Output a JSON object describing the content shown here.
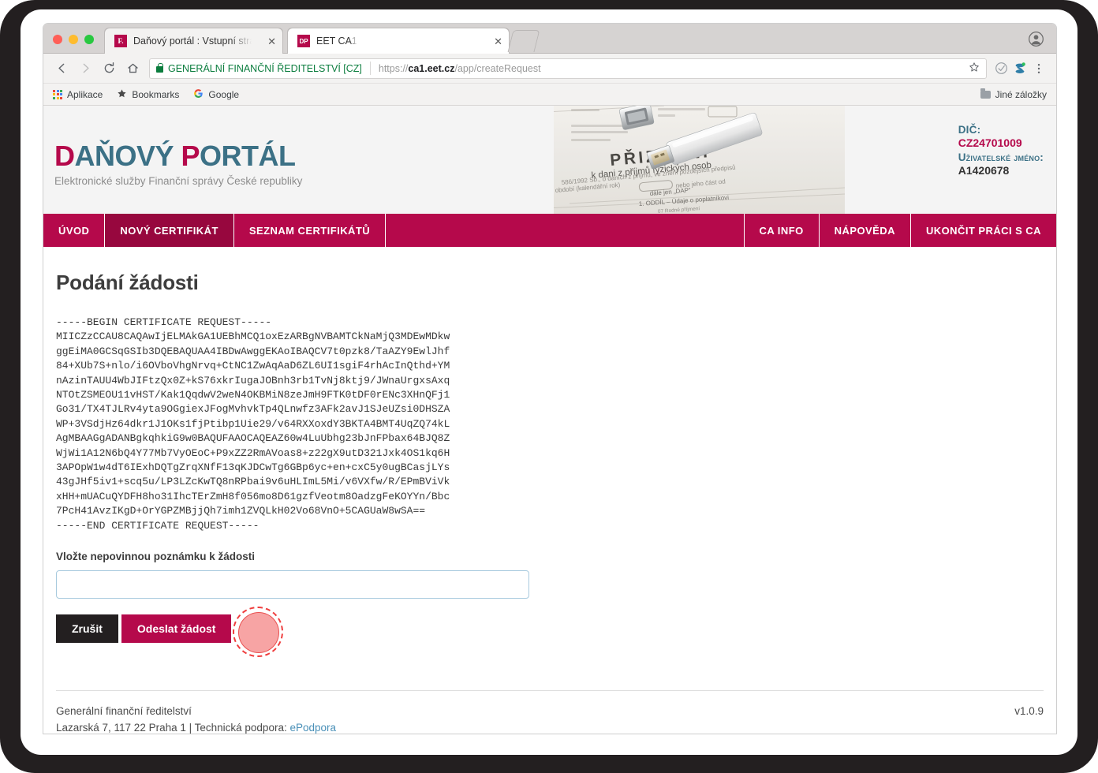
{
  "browser": {
    "tabs": [
      {
        "favicon": "favicon-danovy-portal",
        "favicon_text": "F.",
        "title": "Daňový portál :  Vstupní stránk",
        "active": true,
        "close_label": "✕"
      },
      {
        "favicon": "favicon-eet-ca1",
        "favicon_text": "DP",
        "title": "EET CA1",
        "active": false,
        "close_label": "✕"
      }
    ],
    "toolbar": {
      "back_icon": "back-arrow-icon",
      "forward_icon": "forward-arrow-icon",
      "reload_icon": "reload-icon",
      "home_icon": "home-icon",
      "ev_certificate": "GENERÁLNÍ FINANČNÍ ŘEDITELSTVÍ [CZ]",
      "url_scheme": "https://",
      "url_host": "ca1.eet.cz",
      "url_path": "/app/createRequest",
      "star_icon": "bookmark-star-icon",
      "extension_icon": "extension-icon",
      "sync_icon": "sync-icon",
      "menu_icon": "kebab-menu-icon",
      "profile_icon": "profile-avatar-icon"
    },
    "bookmarks": {
      "apps_label": "Aplikace",
      "bookmarks_label": "Bookmarks",
      "google_label": "Google",
      "other_label": "Jiné záložky"
    }
  },
  "site": {
    "logo": {
      "part1_accent": "D",
      "part1_rest": "AŇOVÝ ",
      "part2_accent": "P",
      "part2_rest": "ORTÁL"
    },
    "logo_subtitle": "Elektronické služby Finanční správy České republiky",
    "banner_alt": "priznani-form-usb-photo",
    "identity": {
      "dic_label": "DIČ:",
      "dic_value": "CZ24701009",
      "user_label": "Uživatelské jméno:",
      "user_value": "A1420678"
    },
    "nav_left": [
      {
        "label": "ÚVOD",
        "active": false
      },
      {
        "label": "NOVÝ CERTIFIKÁT",
        "active": true
      },
      {
        "label": "SEZNAM CERTIFIKÁTŮ",
        "active": false
      }
    ],
    "nav_right": [
      {
        "label": "CA INFO",
        "active": false
      },
      {
        "label": "NÁPOVĚDA",
        "active": false
      },
      {
        "label": "UKONČIT PRÁCI S CA",
        "active": false
      }
    ]
  },
  "main": {
    "page_title": "Podání žádosti",
    "certificate_request": "-----BEGIN CERTIFICATE REQUEST-----\nMIICZzCCAU8CAQAwIjELMAkGA1UEBhMCQ1oxEzARBgNVBAMTCkNaMjQ3MDEwMDkw\nggEiMA0GCSqGSIb3DQEBAQUAA4IBDwAwggEKAoIBAQCV7t0pzk8/TaAZY9EwlJhf\n84+XUb7S+nlo/i6OVboVhgNrvq+CtNC1ZwAqAaD6ZL6UI1sgiF4rhAcInQthd+YM\nnAzinTAUU4WbJIFtzQx0Z+kS76xkrIugaJOBnh3rb1TvNj8ktj9/JWnaUrgxsAxq\nNTOtZSMEOU11vHST/Kak1QqdwV2weN4OKBMiN8zeJmH9FTK0tDF0rENc3XHnQFj1\nGo31/TX4TJLRv4yta9OGgiexJFogMvhvkTp4QLnwfz3AFk2avJ1SJeUZsi0DHSZA\nWP+3VSdjHz64dkr1J1OKs1fjPtibp1Uie29/v64RXXoxdY3BKTA4BMT4UqZQ74kL\nAgMBAAGgADANBgkqhkiG9w0BAQUFAAOCAQEAZ60w4LuUbhg23bJnFPbax64BJQ8Z\nWjWi1A12N6bQ4Y77Mb7VyOEoC+P9xZZ2RmAVoas8+z22gX9utD321Jxk4OS1kq6H\n3APOpW1w4dT6IExhDQTgZrqXNfF13qKJDCwTg6GBp6yc+en+cxC5y0ugBCasjLYs\n43gJHf5iv1+scq5u/LP3LZcKwTQ8nRPbai9v6uHLImL5Mi/v6VXfw/R/EPmBViVk\nxHH+mUACuQYDFH8ho31IhcTErZmH8f056mo8D61gzfVeotm8OadzgFeKOYYn/Bbc\n7PcH41AvzIKgD+OrYGPZMBjjQh7imh1ZVQLkH02Vo68VnO+5CAGUaW8wSA==\n-----END CERTIFICATE REQUEST-----",
    "note_label": "Vložte nepovinnou poznámku k žádosti",
    "note_value": "",
    "note_placeholder": "",
    "cancel_label": "Zrušit",
    "submit_label": "Odeslat žádost",
    "click_indicator": "click-target-indicator"
  },
  "footer": {
    "org": "Generální finanční ředitelství",
    "address": "Lazarská 7, 117 22 Praha 1 | Technická podpora: ",
    "support_link": "ePodpora",
    "version": "v1.0.9"
  },
  "colors": {
    "brand_crimson": "#b5094b",
    "brand_crimson_dark": "#97073e",
    "logo_teal": "#3c7186",
    "link_blue": "#4a90b8",
    "dark_button": "#231f20"
  }
}
